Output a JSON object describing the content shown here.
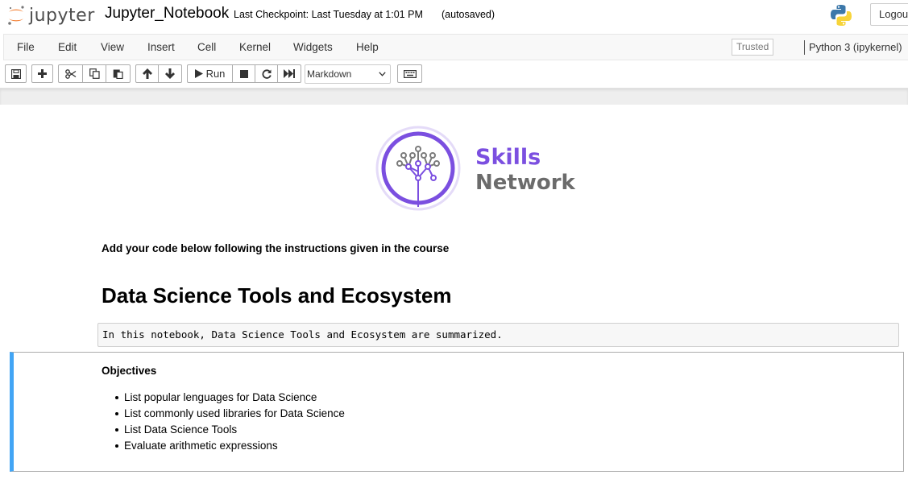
{
  "header": {
    "brand": "jupyter",
    "notebook_name": "Jupyter_Notebook",
    "checkpoint": "Last Checkpoint: Last Tuesday at 1:01 PM",
    "autosave": "(autosaved)",
    "logout_label": "Logout"
  },
  "menubar": {
    "items": [
      "File",
      "Edit",
      "View",
      "Insert",
      "Cell",
      "Kernel",
      "Widgets",
      "Help"
    ],
    "trusted": "Trusted",
    "kernel": "Python 3 (ipykernel)"
  },
  "toolbar": {
    "run_label": "Run",
    "cell_type": "Markdown"
  },
  "logo": {
    "line1": "Skills",
    "line2": "Network",
    "colors": {
      "purple": "#7b4fe0",
      "gray": "#6b6b6b",
      "ring": "#e4dbf8"
    }
  },
  "notebook": {
    "intro": "Add your code below following the instructions given in the course",
    "heading": "Data Science Tools and Ecosystem",
    "code_line": "In this notebook, Data Science Tools and Ecosystem are summarized.",
    "objectives_title": "Objectives",
    "objectives": [
      "List popular lenguages for Data Science",
      "List commonly used libraries for Data Science",
      "List Data Science Tools",
      "Evaluate arithmetic expressions"
    ]
  },
  "colors": {
    "selected_cell_bar": "#42a5f5",
    "jupyter_orange": "#f37726"
  }
}
